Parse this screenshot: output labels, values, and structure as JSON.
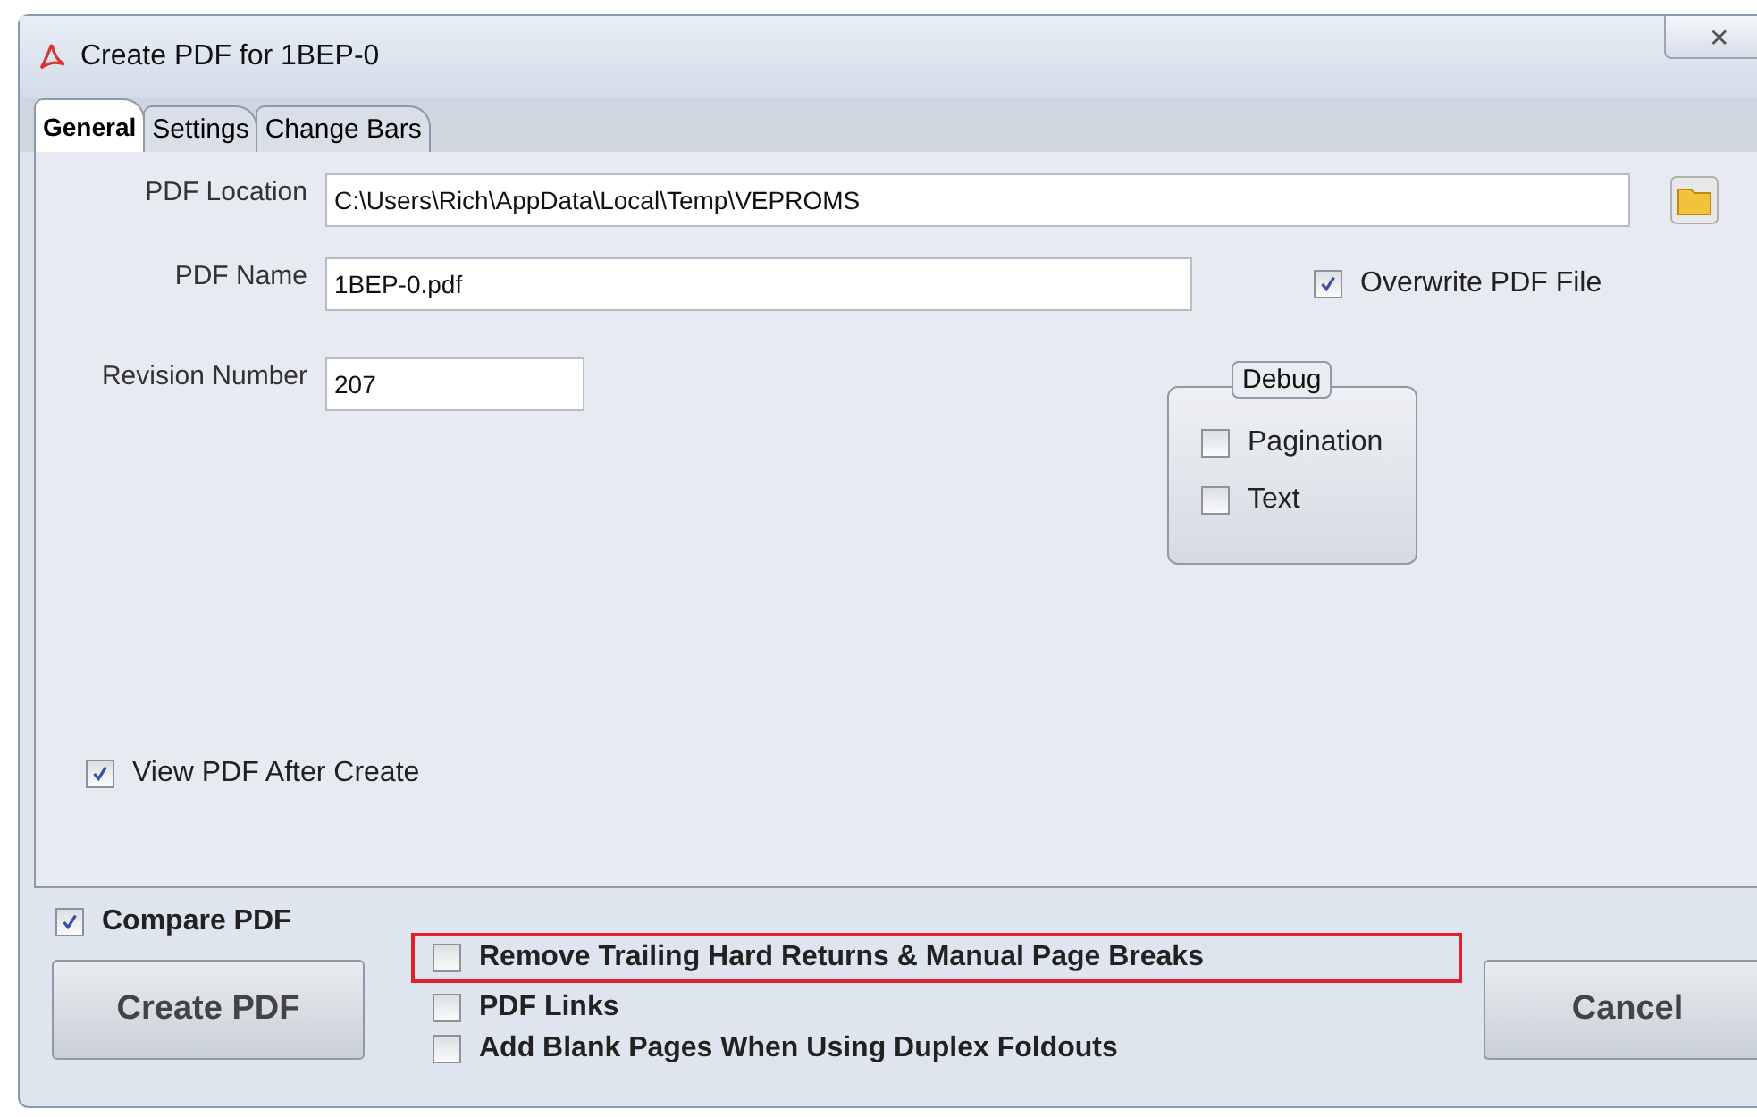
{
  "window": {
    "title": "Create PDF for 1BEP-0",
    "close": "✕"
  },
  "tabs": [
    {
      "label": "General",
      "selected": true
    },
    {
      "label": "Settings",
      "selected": false
    },
    {
      "label": "Change Bars",
      "selected": false
    }
  ],
  "general": {
    "location": {
      "label": "PDF Location",
      "value": "C:\\Users\\Rich\\AppData\\Local\\Temp\\VEPROMS"
    },
    "name": {
      "label": "PDF Name",
      "value": "1BEP-0.pdf"
    },
    "overwrite": {
      "label": "Overwrite PDF File",
      "checked": true
    },
    "revision": {
      "label": "Revision Number",
      "value": "207"
    },
    "debug": {
      "title": "Debug",
      "options": [
        {
          "label": "Pagination",
          "checked": false
        },
        {
          "label": "Text",
          "checked": false
        }
      ]
    },
    "view_after": {
      "label": "View PDF After Create",
      "checked": true
    }
  },
  "compare": {
    "label": "Compare PDF",
    "checked": true
  },
  "create_button": "Create PDF",
  "options": [
    {
      "label": "Remove Trailing Hard Returns & Manual Page Breaks",
      "checked": false,
      "highlighted": true
    },
    {
      "label": "PDF Links",
      "checked": false,
      "highlighted": false
    },
    {
      "label": "Add Blank Pages When Using Duplex Foldouts",
      "checked": false,
      "highlighted": false
    }
  ],
  "cancel_button": "Cancel"
}
